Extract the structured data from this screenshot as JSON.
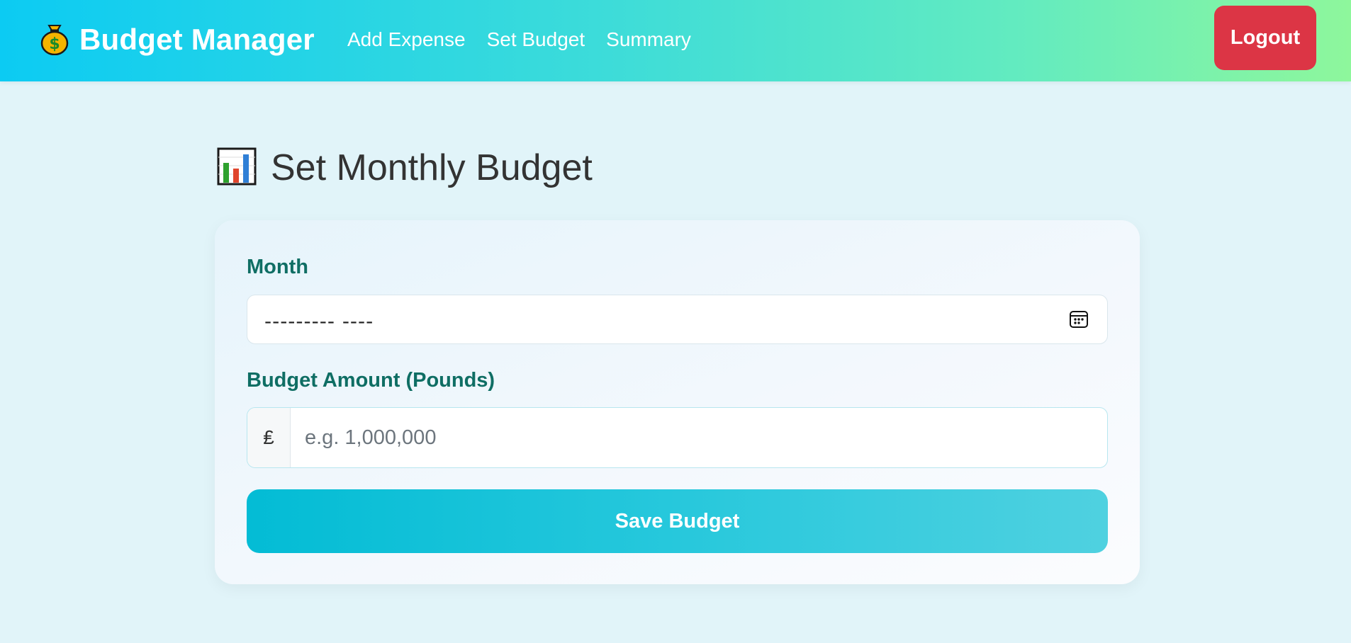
{
  "navbar": {
    "brand_icon": "money-bag-icon",
    "brand": "Budget Manager",
    "links": [
      {
        "label": "Add Expense"
      },
      {
        "label": "Set Budget"
      },
      {
        "label": "Summary"
      }
    ],
    "logout_label": "Logout"
  },
  "page": {
    "title_icon": "bar-chart-icon",
    "title": "Set Monthly Budget"
  },
  "form": {
    "month_label": "Month",
    "month_value": "--------- ----",
    "month_icon": "calendar-icon",
    "amount_label": "Budget Amount (Pounds)",
    "currency_symbol": "₤",
    "amount_placeholder": "e.g. 1,000,000",
    "amount_value": "",
    "save_label": "Save Budget"
  },
  "colors": {
    "header_gradient_start": "#0ccbf3",
    "header_gradient_end": "#8ef79c",
    "logout": "#dc3545",
    "label": "#0f6e64",
    "save_gradient_start": "#03bcd5",
    "save_gradient_end": "#4fd1e0",
    "background": "#e1f4f9"
  }
}
